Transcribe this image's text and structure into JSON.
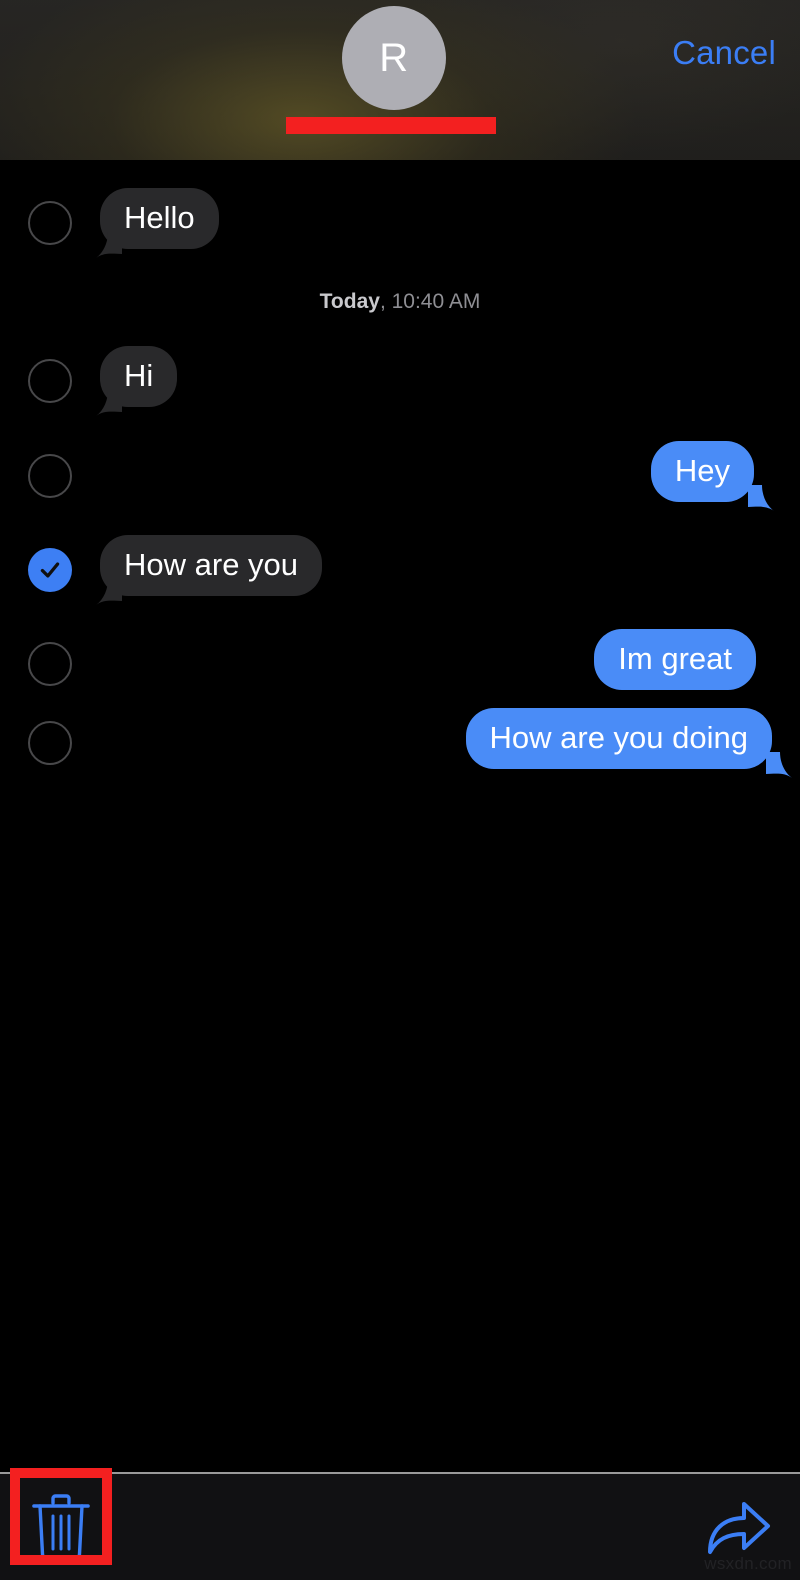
{
  "header": {
    "avatar_letter": "R",
    "contact_name": "",
    "contact_name_redacted": true,
    "cancel_label": "Cancel",
    "accent_color": "#3b7ef5",
    "redaction_color": "#f32020",
    "avatar_color": "#aeaeb4"
  },
  "conversation": {
    "timestamp": {
      "day": "Today",
      "time": ", 10:40 AM"
    },
    "messages": [
      {
        "text": "Hello",
        "direction": "incoming",
        "selected": false,
        "tail": true
      },
      {
        "text": "Hi",
        "direction": "incoming",
        "selected": false,
        "tail": true
      },
      {
        "text": "Hey",
        "direction": "outgoing",
        "selected": false,
        "tail": true
      },
      {
        "text": "How are you",
        "direction": "incoming",
        "selected": true,
        "tail": true
      },
      {
        "text": "Im great",
        "direction": "outgoing",
        "selected": false,
        "tail": false
      },
      {
        "text": "How are you doing",
        "direction": "outgoing",
        "selected": false,
        "tail": true
      }
    ],
    "incoming_bubble_color": "#29292b",
    "outgoing_bubble_color": "#4a8cf7",
    "checkbox_checked_color": "#3d7ff4"
  },
  "toolbar": {
    "delete_icon": "trash-icon",
    "forward_icon": "forward-arrow-icon",
    "icon_color": "#3b7ef5"
  },
  "annotation": {
    "target": "trash-icon",
    "box_color": "#f32020"
  },
  "watermark": {
    "text": "wsxdn.com"
  }
}
